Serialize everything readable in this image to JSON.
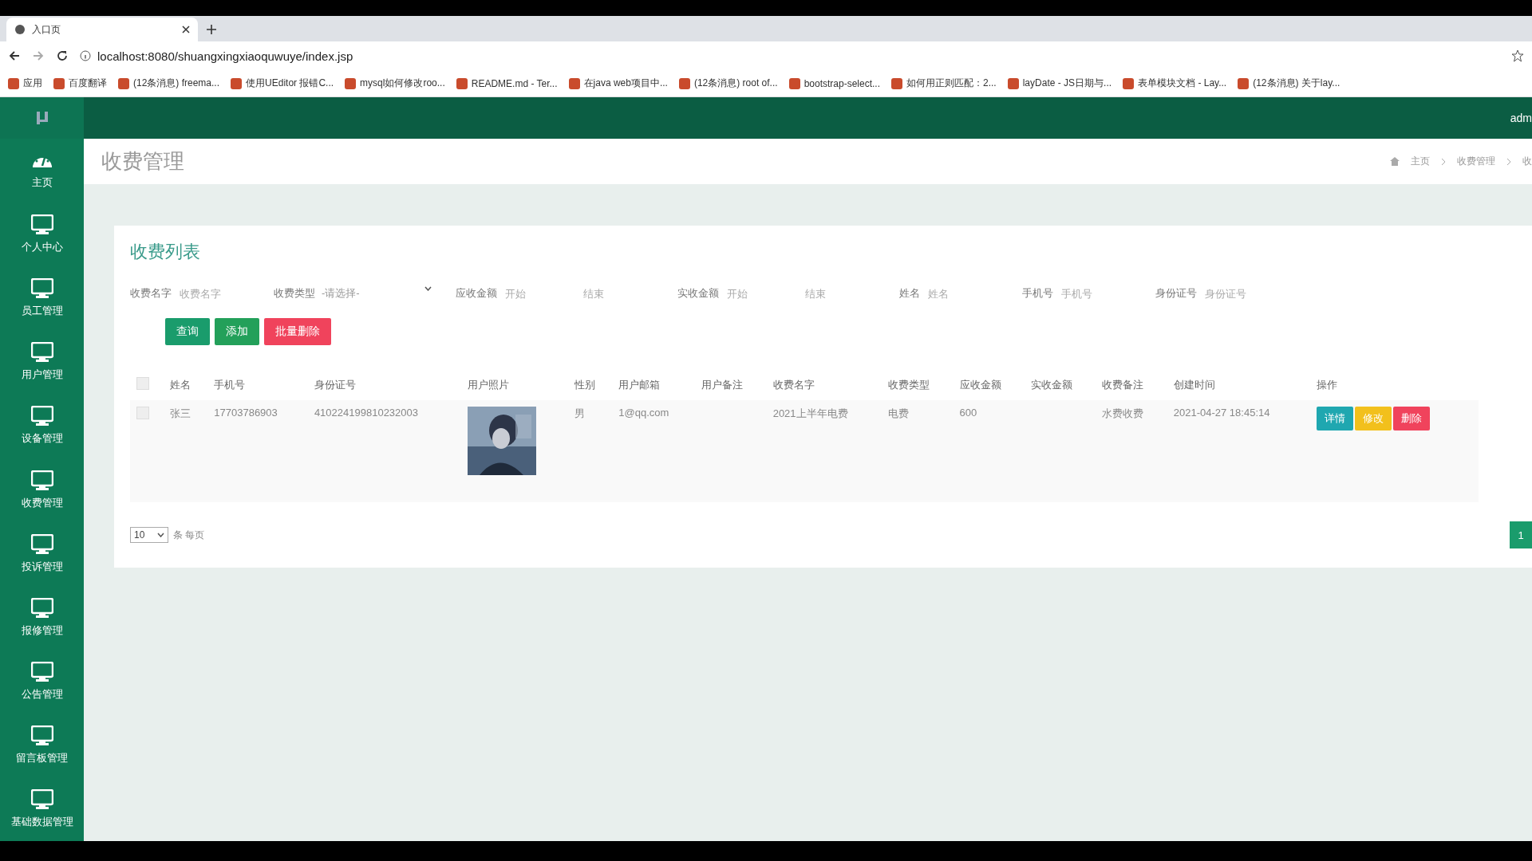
{
  "browser": {
    "tab_title": "入口页",
    "url": "localhost:8080/shuangxingxiaoquwuye/index.jsp",
    "bookmarks": [
      "应用",
      "百度翻译",
      "(12条消息) freema...",
      "使用UEditor 报错C...",
      "mysql如何修改roo...",
      "README.md - Ter...",
      "在java web项目中...",
      "(12条消息) root of...",
      "bootstrap-select...",
      "如何用正则匹配：2...",
      "layDate - JS日期与...",
      "表单模块文档 - Lay...",
      "(12条消息) 关于lay..."
    ]
  },
  "header": {
    "user": "adm"
  },
  "sidebar": {
    "items": [
      {
        "label": "主页",
        "kind": "dashboard"
      },
      {
        "label": "个人中心",
        "kind": "monitor"
      },
      {
        "label": "员工管理",
        "kind": "monitor"
      },
      {
        "label": "用户管理",
        "kind": "monitor"
      },
      {
        "label": "设备管理",
        "kind": "monitor"
      },
      {
        "label": "收费管理",
        "kind": "monitor"
      },
      {
        "label": "投诉管理",
        "kind": "monitor"
      },
      {
        "label": "报修管理",
        "kind": "monitor"
      },
      {
        "label": "公告管理",
        "kind": "monitor"
      },
      {
        "label": "留言板管理",
        "kind": "monitor"
      },
      {
        "label": "基础数据管理",
        "kind": "monitor"
      }
    ]
  },
  "page": {
    "title": "收费管理",
    "breadcrumb": [
      "主页",
      "收费管理",
      "收"
    ]
  },
  "card": {
    "title": "收费列表",
    "filters": [
      {
        "kind": "text",
        "label": "收费名字",
        "placeholder": "收费名字"
      },
      {
        "kind": "select",
        "label": "收费类型",
        "value": "-请选择-"
      },
      {
        "kind": "range",
        "label": "应收金额",
        "fields": [
          {
            "placeholder": "开始"
          },
          {
            "placeholder": "结束"
          }
        ]
      },
      {
        "kind": "range",
        "label": "实收金额",
        "fields": [
          {
            "placeholder": "开始"
          },
          {
            "placeholder": "结束"
          }
        ]
      },
      {
        "kind": "text",
        "label": "姓名",
        "placeholder": "姓名"
      },
      {
        "kind": "text",
        "label": "手机号",
        "placeholder": "手机号"
      },
      {
        "kind": "text",
        "label": "身份证号",
        "placeholder": "身份证号"
      }
    ],
    "actions": [
      {
        "label": "查询",
        "kind": "primary"
      },
      {
        "label": "添加",
        "kind": "success"
      },
      {
        "label": "批量删除",
        "kind": "danger"
      }
    ],
    "table": {
      "select_all_checked": false,
      "columns": [
        "姓名",
        "手机号",
        "身份证号",
        "用户照片",
        "性别",
        "用户邮箱",
        "用户备注",
        "收费名字",
        "收费类型",
        "应收金额",
        "实收金额",
        "收费备注",
        "创建时间",
        "操作"
      ],
      "rows": [
        {
          "checked": false,
          "cells": [
            "张三",
            "17703786903",
            "410224199810232003",
            {
              "kind": "picture"
            },
            "男",
            "1@qq.com",
            "",
            "2021上半年电费",
            "电费",
            "600",
            "",
            "水费收费",
            "2021-04-27 18:45:14"
          ],
          "buttons": [
            {
              "label": "详情",
              "kind": "info"
            },
            {
              "label": "修改",
              "kind": "warning"
            },
            {
              "label": "删除",
              "kind": "danger"
            }
          ]
        }
      ]
    },
    "pagination": {
      "page_size": "10",
      "page_size_label": "条 每页",
      "pages": [
        {
          "label": "1",
          "selected": true
        }
      ]
    }
  }
}
